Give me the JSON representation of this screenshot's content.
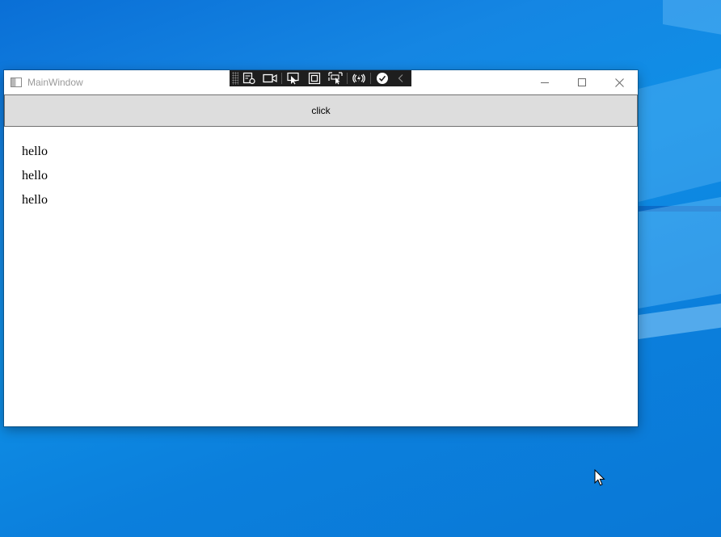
{
  "window": {
    "title": "MainWindow",
    "controls": {
      "minimize_icon": "minimize-icon",
      "maximize_icon": "maximize-icon",
      "close_icon": "close-icon"
    }
  },
  "debug_toolbar": {
    "tools": [
      "live-visual-tree-icon",
      "video-icon",
      "select-element-icon",
      "display-layout-adorners-icon",
      "track-focus-icon",
      "hot-reload-icon",
      "accessibility-check-icon",
      "collapse-chevron-icon"
    ]
  },
  "main": {
    "button_label": "click",
    "items": [
      "hello",
      "hello",
      "hello"
    ]
  },
  "colors": {
    "desktop": "#0a78d6",
    "button_bg": "#dddddd",
    "button_border": "#707070",
    "toolbar_bg": "#1e1e1e"
  }
}
